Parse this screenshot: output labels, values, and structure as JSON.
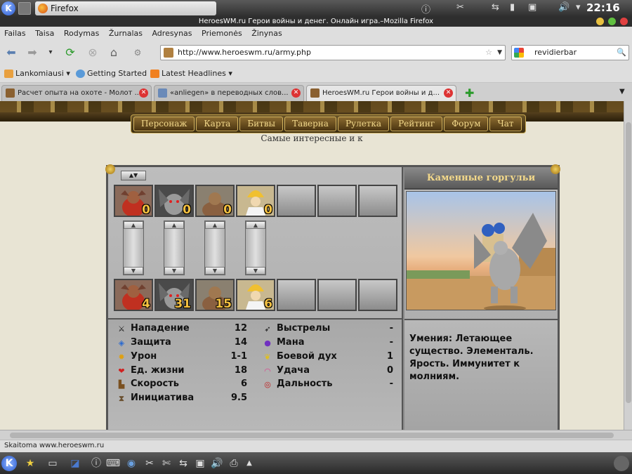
{
  "top_panel": {
    "task_label": "Firefox",
    "clock": "22:16",
    "colors": {
      "panel": "#3a3a3a"
    }
  },
  "window": {
    "title": "HeroesWM.ru Герои войны и денег. Онлайн игра.–Mozilla Firefox"
  },
  "menu": [
    "Failas",
    "Taisa",
    "Rodymas",
    "Žurnalas",
    "Adresynas",
    "Priemonės",
    "Žinynas"
  ],
  "nav": {
    "url": "http://www.heroeswm.ru/army.php",
    "search_value": "revidierbar"
  },
  "bookmarks": [
    "Lankomiausi",
    "Getting Started",
    "Latest Headlines"
  ],
  "tabs": [
    {
      "label": "Расчет опыта на охоте - Молот ...",
      "active": false
    },
    {
      "label": "«anliegen» в переводных слов...",
      "active": false
    },
    {
      "label": "HeroesWM.ru Герои войны и д...",
      "active": true
    }
  ],
  "game": {
    "nav_items": [
      "Персонаж",
      "Карта",
      "Битвы",
      "Таверна",
      "Рулетка",
      "Рейтинг",
      "Форум",
      "Чат"
    ],
    "tagline": "Самые интересные и к",
    "sort_label": "▲▼",
    "top_slots": [
      {
        "name": "imp",
        "count": "0"
      },
      {
        "name": "gargoyle",
        "count": "0"
      },
      {
        "name": "golem",
        "count": "0"
      },
      {
        "name": "mage",
        "count": "0"
      }
    ],
    "bottom_slots": [
      {
        "name": "imp",
        "count": "4"
      },
      {
        "name": "gargoyle",
        "count": "31"
      },
      {
        "name": "golem",
        "count": "15"
      },
      {
        "name": "mage",
        "count": "6"
      }
    ],
    "stats_left": [
      {
        "label": "Нападение",
        "value": "12",
        "icon": "swords-icon"
      },
      {
        "label": "Защита",
        "value": "14",
        "icon": "shield-icon"
      },
      {
        "label": "Урон",
        "value": "1-1",
        "icon": "burst-icon"
      },
      {
        "label": "Ед. жизни",
        "value": "18",
        "icon": "heart-icon"
      },
      {
        "label": "Скорость",
        "value": "6",
        "icon": "boot-icon"
      },
      {
        "label": "Инициатива",
        "value": "9.5",
        "icon": "hourglass-icon"
      }
    ],
    "stats_right": [
      {
        "label": "Выстрелы",
        "value": "-",
        "icon": "arrow-icon"
      },
      {
        "label": "Мана",
        "value": "-",
        "icon": "mana-orb-icon"
      },
      {
        "label": "Боевой дух",
        "value": "1",
        "icon": "wings-icon"
      },
      {
        "label": "Удача",
        "value": "0",
        "icon": "rainbow-icon"
      },
      {
        "label": "Дальность",
        "value": "-",
        "icon": "target-icon"
      }
    ],
    "creature_name": "Каменные горгульи",
    "abilities": "Умения: Летающее существо. Элементаль. Ярость. Иммунитет к молниям."
  },
  "status": "Skaitoma www.heroeswm.ru"
}
